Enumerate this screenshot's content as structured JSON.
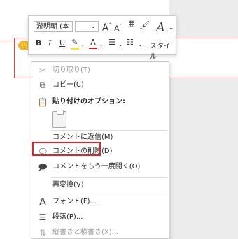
{
  "toolbar": {
    "font_name": "游明朝 (本",
    "font_size": "",
    "grow_font": "A",
    "shrink_font": "A",
    "ruby": "亜",
    "bold": "B",
    "italic": "I",
    "underline": "U",
    "font_color": "A",
    "style_label": "スタイル"
  },
  "menu": {
    "cut": "切り取り(T)",
    "copy": "コピー(C)",
    "paste_options": "貼り付けのオプション:",
    "reply_comment": "コメントに返信(M)",
    "delete_comment": "コメントの削除(D)",
    "reopen_comment": "コメントをもう一度開く(O)",
    "reconvert": "再変換(V)",
    "font": "フォント(F)...",
    "paragraph": "段落(P)...",
    "vertical_horizontal": "縦書きと横書き(X)..."
  },
  "colors": {
    "highlight_border": "#e0242a",
    "comment_line": "#d64a4a",
    "font_color_bar": "#d02020",
    "highlight_bar": "#f7e34a"
  }
}
